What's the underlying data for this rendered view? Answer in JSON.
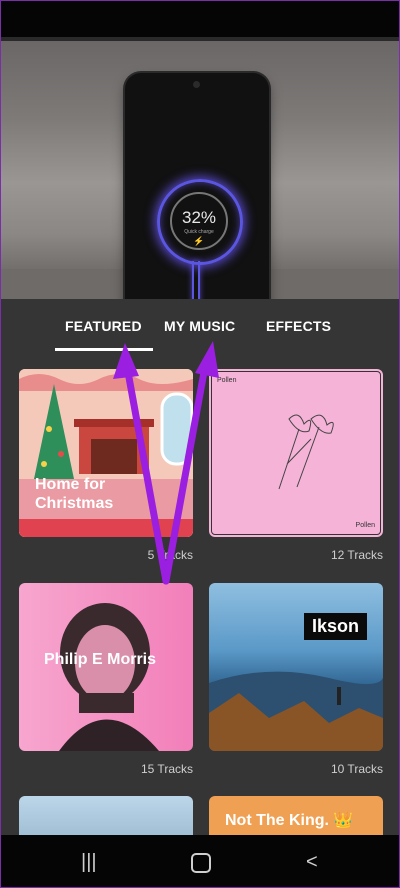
{
  "preview": {
    "charge_percent": "32%",
    "charge_label": "Quick charge"
  },
  "tabs": [
    {
      "label": "FEATURED",
      "selected": true
    },
    {
      "label": "MY MUSIC",
      "selected": false
    },
    {
      "label": "EFFECTS",
      "selected": false
    }
  ],
  "albums": [
    {
      "title": "Home for Christmas",
      "tracks": "5 Tracks"
    },
    {
      "title": "Pollen",
      "tracks": "12 Tracks"
    },
    {
      "title": "Philip E Morris",
      "tracks": "15 Tracks"
    },
    {
      "title": "Ikson",
      "tracks": "10 Tracks"
    },
    {
      "title": "",
      "tracks": ""
    },
    {
      "title": "Not The King. 👑",
      "tracks": ""
    }
  ],
  "nav": {
    "recents_icon": "recents-icon",
    "home_icon": "home-icon",
    "back_icon": "back-icon"
  },
  "colors": {
    "annotation_arrow": "#9b1fe0",
    "background": "#353535"
  }
}
